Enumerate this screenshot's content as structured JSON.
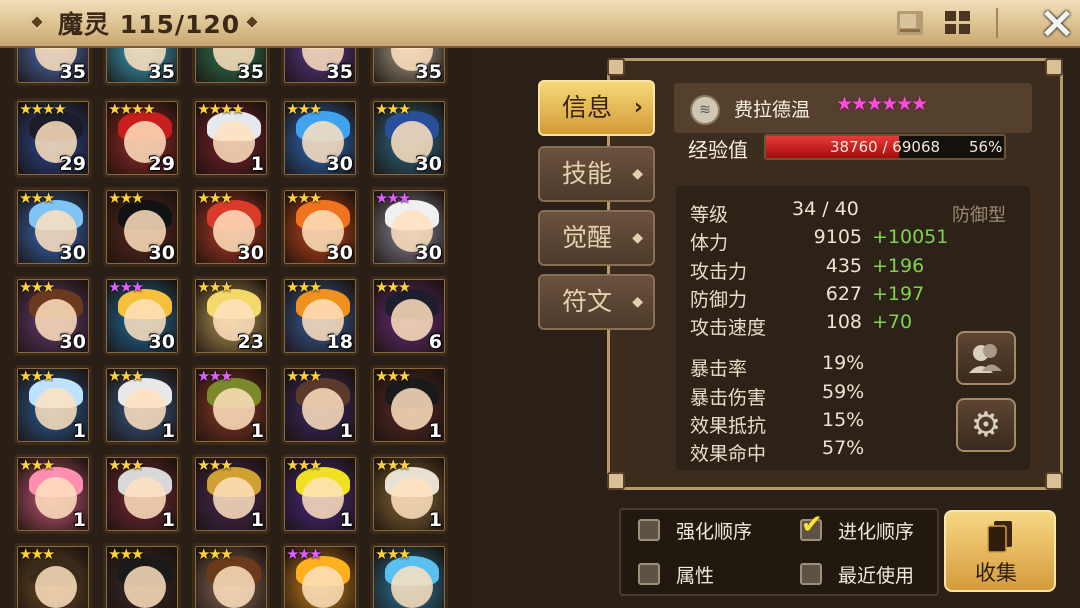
{
  "header": {
    "title": "魔灵 115/120",
    "close_icon": "×"
  },
  "tabs": [
    {
      "label": "信息",
      "active": true
    },
    {
      "label": "技能",
      "active": false
    },
    {
      "label": "觉醒",
      "active": false
    },
    {
      "label": "符文",
      "active": false
    }
  ],
  "monster": {
    "name": "费拉德温",
    "stars": "★★★★★★",
    "exp_label": "经验值",
    "exp_text": "38760 / 69068",
    "exp_percent": "56%",
    "exp_fraction": 0.56,
    "type": "防御型",
    "stats": [
      {
        "label": "等级",
        "value": "34 / 40",
        "bonus": ""
      },
      {
        "label": "体力",
        "value": "9105",
        "bonus": "+10051"
      },
      {
        "label": "攻击力",
        "value": "435",
        "bonus": "+196"
      },
      {
        "label": "防御力",
        "value": "627",
        "bonus": "+197"
      },
      {
        "label": "攻击速度",
        "value": "108",
        "bonus": "+70"
      }
    ],
    "sub_stats": [
      {
        "label": "暴击率",
        "value": "19%"
      },
      {
        "label": "暴击伤害",
        "value": "59%"
      },
      {
        "label": "效果抵抗",
        "value": "15%"
      },
      {
        "label": "效果命中",
        "value": "57%"
      }
    ]
  },
  "filters": [
    {
      "label": "强化顺序",
      "checked": false
    },
    {
      "label": "进化顺序",
      "checked": true
    },
    {
      "label": "属性",
      "checked": false
    },
    {
      "label": "最近使用",
      "checked": false
    }
  ],
  "collect_label": "收集",
  "check_glyph": "✔",
  "gear_glyph": "⚙",
  "grid": [
    {
      "stars": "",
      "star_color": "#ffd23c",
      "level": "35",
      "bg": "#4d6fb8",
      "hair": "#f2d05a"
    },
    {
      "stars": "",
      "star_color": "#ffd23c",
      "level": "35",
      "bg": "#3aa6c9",
      "hair": "#dff3f7"
    },
    {
      "stars": "",
      "star_color": "#ffd23c",
      "level": "35",
      "bg": "#2f7a5a",
      "hair": "#b94a2f"
    },
    {
      "stars": "",
      "star_color": "#ffd23c",
      "level": "35",
      "bg": "#5a3a8f",
      "hair": "#d9b04a"
    },
    {
      "stars": "",
      "star_color": "#ffd23c",
      "level": "35",
      "bg": "#a89c8a",
      "hair": "#f3f0e8"
    },
    {
      "stars": "★★★★",
      "star_color": "#ffd23c",
      "level": "29",
      "bg": "#2b4a9a",
      "hair": "#1c1c2a"
    },
    {
      "stars": "★★★★",
      "star_color": "#ffd23c",
      "level": "29",
      "bg": "#9a2a2a",
      "hair": "#c81e1e"
    },
    {
      "stars": "★★★★",
      "star_color": "#ffd23c",
      "level": "1",
      "bg": "#7a2230",
      "hair": "#e8e8ef"
    },
    {
      "stars": "★★★",
      "star_color": "#ffd23c",
      "level": "30",
      "bg": "#2d6fc9",
      "hair": "#3fa3f0"
    },
    {
      "stars": "★★★",
      "star_color": "#ffd23c",
      "level": "30",
      "bg": "#2e6c8a",
      "hair": "#2a4f9a"
    },
    {
      "stars": "★★★",
      "star_color": "#ffd23c",
      "level": "30",
      "bg": "#3a6cc0",
      "hair": "#7fc4f2"
    },
    {
      "stars": "★★★",
      "star_color": "#ffd23c",
      "level": "30",
      "bg": "#5a2a22",
      "hair": "#121212"
    },
    {
      "stars": "★★★",
      "star_color": "#ffd23c",
      "level": "30",
      "bg": "#b53b2a",
      "hair": "#d93a2a"
    },
    {
      "stars": "★★★",
      "star_color": "#ffd23c",
      "level": "30",
      "bg": "#c4481e",
      "hair": "#f0731e"
    },
    {
      "stars": "★★★",
      "star_color": "#e060ff",
      "level": "30",
      "bg": "#8a8a9e",
      "hair": "#f0f0f0"
    },
    {
      "stars": "★★★",
      "star_color": "#ffd23c",
      "level": "30",
      "bg": "#6a3d7a",
      "hair": "#6b3a1e"
    },
    {
      "stars": "★★★",
      "star_color": "#e060ff",
      "level": "30",
      "bg": "#1f6fa3",
      "hair": "#f5c13c"
    },
    {
      "stars": "★★★",
      "star_color": "#ffd23c",
      "level": "23",
      "bg": "#b99a5a",
      "hair": "#f3d86a"
    },
    {
      "stars": "★★★",
      "star_color": "#ffd23c",
      "level": "18",
      "bg": "#3a5fa2",
      "hair": "#f0901e"
    },
    {
      "stars": "★★★",
      "star_color": "#ffd23c",
      "level": "6",
      "bg": "#6a2d7a",
      "hair": "#1e1e2e"
    },
    {
      "stars": "★★★",
      "star_color": "#ffd23c",
      "level": "1",
      "bg": "#2a5fa0",
      "hair": "#bfe3ff"
    },
    {
      "stars": "★★★",
      "star_color": "#ffd23c",
      "level": "1",
      "bg": "#3b5a8a",
      "hair": "#e8e8e8"
    },
    {
      "stars": "★★★",
      "star_color": "#e060ff",
      "level": "1",
      "bg": "#8a3a2a",
      "hair": "#7a8a2a"
    },
    {
      "stars": "★★★",
      "star_color": "#ffd23c",
      "level": "1",
      "bg": "#3a2a6a",
      "hair": "#5a3a2a"
    },
    {
      "stars": "★★★",
      "star_color": "#ffd23c",
      "level": "1",
      "bg": "#5a2a2a",
      "hair": "#1a1a1a"
    },
    {
      "stars": "★★★",
      "star_color": "#ffd23c",
      "level": "1",
      "bg": "#c85a7a",
      "hair": "#ff8fb0"
    },
    {
      "stars": "★★★",
      "star_color": "#ffd23c",
      "level": "1",
      "bg": "#7a2a3a",
      "hair": "#d8d8d8"
    },
    {
      "stars": "★★★",
      "star_color": "#ffd23c",
      "level": "1",
      "bg": "#4a2a5a",
      "hair": "#d0a030"
    },
    {
      "stars": "★★★",
      "star_color": "#ffd23c",
      "level": "1",
      "bg": "#4a2a8a",
      "hair": "#f0e020"
    },
    {
      "stars": "★★★",
      "star_color": "#ffd23c",
      "level": "1",
      "bg": "#8a6a3a",
      "hair": "#e8e0d0"
    },
    {
      "stars": "★★★",
      "star_color": "#ffd23c",
      "level": "",
      "bg": "#6a4a2a",
      "hair": "#3a2a1a"
    },
    {
      "stars": "★★★",
      "star_color": "#ffd23c",
      "level": "",
      "bg": "#3a2a2a",
      "hair": "#1a1a1a"
    },
    {
      "stars": "★★★",
      "star_color": "#ffd23c",
      "level": "",
      "bg": "#8a6a5a",
      "hair": "#6a3a1a"
    },
    {
      "stars": "★★★",
      "star_color": "#e060ff",
      "level": "",
      "bg": "#c8801e",
      "hair": "#ffb01e"
    },
    {
      "stars": "★★★",
      "star_color": "#ffd23c",
      "level": "",
      "bg": "#2a7aa3",
      "hair": "#5ac0f0"
    }
  ]
}
